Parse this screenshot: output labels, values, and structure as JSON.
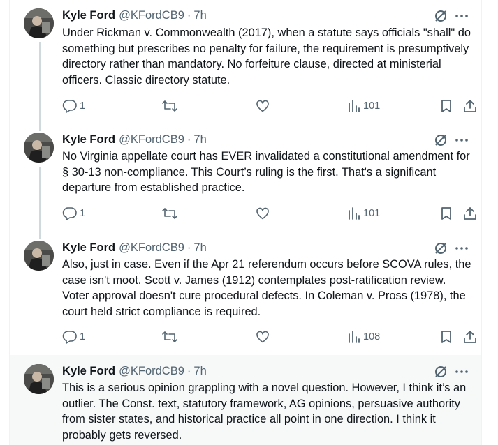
{
  "tweets": [
    {
      "author_name": "Kyle Ford",
      "handle": "@KFordCB9",
      "separator": "·",
      "time": "7h",
      "text": "Under Rickman v. Commonwealth (2017), when a statute says officials \"shall\" do something but prescribes no penalty for failure, the requirement is presumptively directory rather than mandatory. No forfeiture clause, directed at ministerial officers. Classic directory statute.",
      "replies": "1",
      "reposts": "",
      "likes": "",
      "views": "101"
    },
    {
      "author_name": "Kyle Ford",
      "handle": "@KFordCB9",
      "separator": "·",
      "time": "7h",
      "text": "No Virginia appellate court has EVER invalidated a constitutional amendment for § 30-13 non-compliance. This Court’s ruling is the first. That's a significant departure from established practice.",
      "replies": "1",
      "reposts": "",
      "likes": "",
      "views": "101"
    },
    {
      "author_name": "Kyle Ford",
      "handle": "@KFordCB9",
      "separator": "·",
      "time": "7h",
      "text": "Also, just in case. Even if the Apr 21 referendum occurs before SCOVA rules, the case isn't moot. Scott v. James (1912) contemplates post-ratification review. Voter approval doesn't cure procedural defects. In Coleman v. Pross (1978), the court held strict compliance is required.",
      "replies": "1",
      "reposts": "",
      "likes": "",
      "views": "108"
    },
    {
      "author_name": "Kyle Ford",
      "handle": "@KFordCB9",
      "separator": "·",
      "time": "7h",
      "text": "This is a serious opinion grappling with a novel question. However, I think it’s an outlier. The Const. text, statutory framework, AG opinions, persuasive authority from sister states, and historical practice all point in one direction. I think it probably gets reversed.",
      "replies": "",
      "reposts": "",
      "likes": "",
      "views": ""
    }
  ],
  "icons": {
    "grok": "grok-slash-icon",
    "more": "more-icon",
    "reply": "reply-icon",
    "repost": "repost-icon",
    "like": "like-icon",
    "views": "views-icon",
    "bookmark": "bookmark-icon",
    "share": "share-icon"
  },
  "colors": {
    "text": "#0f1419",
    "muted": "#536471",
    "thread_line": "#cfd9de",
    "highlight_bg": "#f7f9f9"
  }
}
